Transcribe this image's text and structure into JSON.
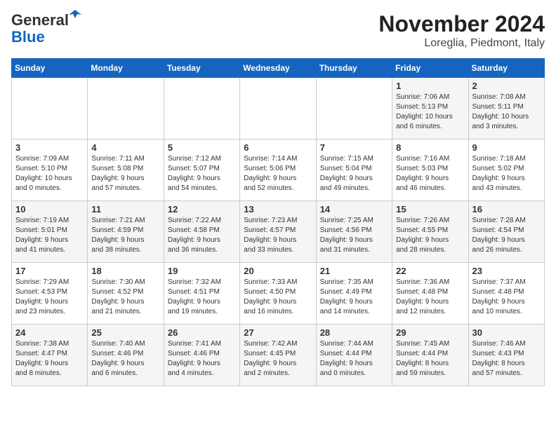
{
  "header": {
    "logo_line1": "General",
    "logo_line2": "Blue",
    "month": "November 2024",
    "location": "Loreglia, Piedmont, Italy"
  },
  "weekdays": [
    "Sunday",
    "Monday",
    "Tuesday",
    "Wednesday",
    "Thursday",
    "Friday",
    "Saturday"
  ],
  "weeks": [
    [
      {
        "day": "",
        "info": ""
      },
      {
        "day": "",
        "info": ""
      },
      {
        "day": "",
        "info": ""
      },
      {
        "day": "",
        "info": ""
      },
      {
        "day": "",
        "info": ""
      },
      {
        "day": "1",
        "info": "Sunrise: 7:06 AM\nSunset: 5:13 PM\nDaylight: 10 hours\nand 6 minutes."
      },
      {
        "day": "2",
        "info": "Sunrise: 7:08 AM\nSunset: 5:11 PM\nDaylight: 10 hours\nand 3 minutes."
      }
    ],
    [
      {
        "day": "3",
        "info": "Sunrise: 7:09 AM\nSunset: 5:10 PM\nDaylight: 10 hours\nand 0 minutes."
      },
      {
        "day": "4",
        "info": "Sunrise: 7:11 AM\nSunset: 5:08 PM\nDaylight: 9 hours\nand 57 minutes."
      },
      {
        "day": "5",
        "info": "Sunrise: 7:12 AM\nSunset: 5:07 PM\nDaylight: 9 hours\nand 54 minutes."
      },
      {
        "day": "6",
        "info": "Sunrise: 7:14 AM\nSunset: 5:06 PM\nDaylight: 9 hours\nand 52 minutes."
      },
      {
        "day": "7",
        "info": "Sunrise: 7:15 AM\nSunset: 5:04 PM\nDaylight: 9 hours\nand 49 minutes."
      },
      {
        "day": "8",
        "info": "Sunrise: 7:16 AM\nSunset: 5:03 PM\nDaylight: 9 hours\nand 46 minutes."
      },
      {
        "day": "9",
        "info": "Sunrise: 7:18 AM\nSunset: 5:02 PM\nDaylight: 9 hours\nand 43 minutes."
      }
    ],
    [
      {
        "day": "10",
        "info": "Sunrise: 7:19 AM\nSunset: 5:01 PM\nDaylight: 9 hours\nand 41 minutes."
      },
      {
        "day": "11",
        "info": "Sunrise: 7:21 AM\nSunset: 4:59 PM\nDaylight: 9 hours\nand 38 minutes."
      },
      {
        "day": "12",
        "info": "Sunrise: 7:22 AM\nSunset: 4:58 PM\nDaylight: 9 hours\nand 36 minutes."
      },
      {
        "day": "13",
        "info": "Sunrise: 7:23 AM\nSunset: 4:57 PM\nDaylight: 9 hours\nand 33 minutes."
      },
      {
        "day": "14",
        "info": "Sunrise: 7:25 AM\nSunset: 4:56 PM\nDaylight: 9 hours\nand 31 minutes."
      },
      {
        "day": "15",
        "info": "Sunrise: 7:26 AM\nSunset: 4:55 PM\nDaylight: 9 hours\nand 28 minutes."
      },
      {
        "day": "16",
        "info": "Sunrise: 7:28 AM\nSunset: 4:54 PM\nDaylight: 9 hours\nand 26 minutes."
      }
    ],
    [
      {
        "day": "17",
        "info": "Sunrise: 7:29 AM\nSunset: 4:53 PM\nDaylight: 9 hours\nand 23 minutes."
      },
      {
        "day": "18",
        "info": "Sunrise: 7:30 AM\nSunset: 4:52 PM\nDaylight: 9 hours\nand 21 minutes."
      },
      {
        "day": "19",
        "info": "Sunrise: 7:32 AM\nSunset: 4:51 PM\nDaylight: 9 hours\nand 19 minutes."
      },
      {
        "day": "20",
        "info": "Sunrise: 7:33 AM\nSunset: 4:50 PM\nDaylight: 9 hours\nand 16 minutes."
      },
      {
        "day": "21",
        "info": "Sunrise: 7:35 AM\nSunset: 4:49 PM\nDaylight: 9 hours\nand 14 minutes."
      },
      {
        "day": "22",
        "info": "Sunrise: 7:36 AM\nSunset: 4:48 PM\nDaylight: 9 hours\nand 12 minutes."
      },
      {
        "day": "23",
        "info": "Sunrise: 7:37 AM\nSunset: 4:48 PM\nDaylight: 9 hours\nand 10 minutes."
      }
    ],
    [
      {
        "day": "24",
        "info": "Sunrise: 7:38 AM\nSunset: 4:47 PM\nDaylight: 9 hours\nand 8 minutes."
      },
      {
        "day": "25",
        "info": "Sunrise: 7:40 AM\nSunset: 4:46 PM\nDaylight: 9 hours\nand 6 minutes."
      },
      {
        "day": "26",
        "info": "Sunrise: 7:41 AM\nSunset: 4:46 PM\nDaylight: 9 hours\nand 4 minutes."
      },
      {
        "day": "27",
        "info": "Sunrise: 7:42 AM\nSunset: 4:45 PM\nDaylight: 9 hours\nand 2 minutes."
      },
      {
        "day": "28",
        "info": "Sunrise: 7:44 AM\nSunset: 4:44 PM\nDaylight: 9 hours\nand 0 minutes."
      },
      {
        "day": "29",
        "info": "Sunrise: 7:45 AM\nSunset: 4:44 PM\nDaylight: 8 hours\nand 59 minutes."
      },
      {
        "day": "30",
        "info": "Sunrise: 7:46 AM\nSunset: 4:43 PM\nDaylight: 8 hours\nand 57 minutes."
      }
    ]
  ]
}
